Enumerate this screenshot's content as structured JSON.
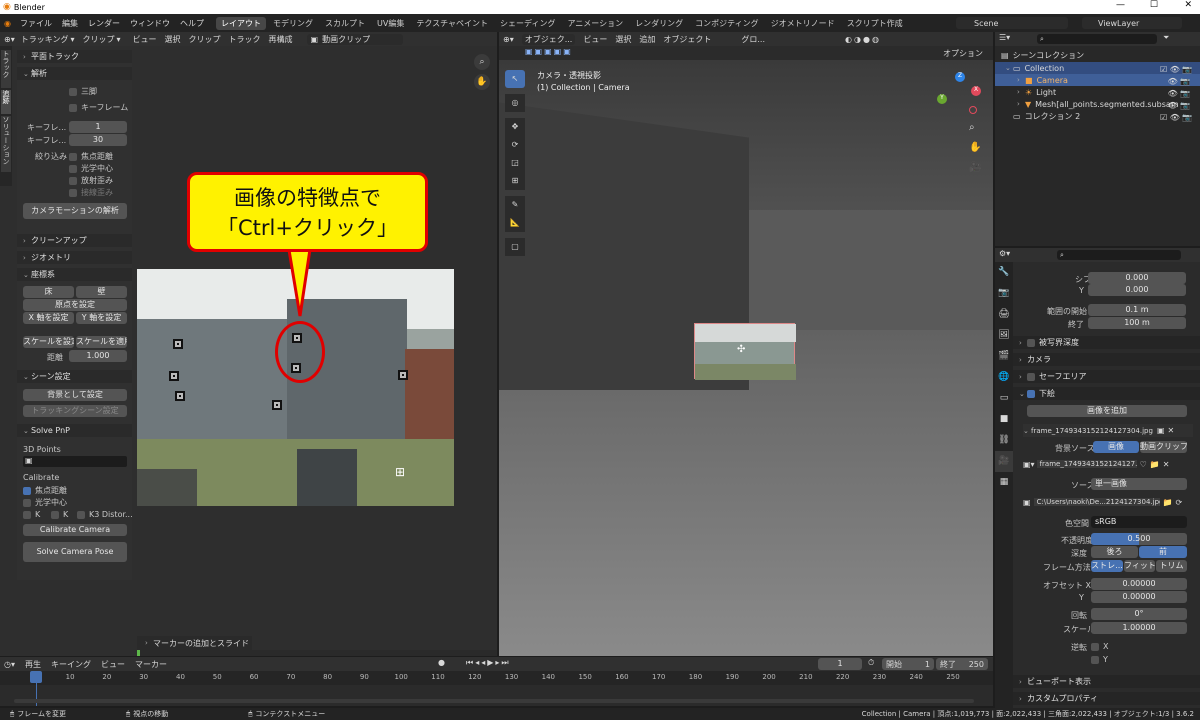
{
  "titlebar": {
    "app": "Blender"
  },
  "menubar": {
    "menus": [
      "ファイル",
      "編集",
      "レンダー",
      "ウィンドウ",
      "ヘルプ"
    ],
    "workspaces": [
      "レイアウト",
      "モデリング",
      "スカルプト",
      "UV編集",
      "テクスチャペイント",
      "シェーディング",
      "アニメーション",
      "レンダリング",
      "コンポジティング",
      "ジオメトリノード",
      "スクリプト作成"
    ],
    "scene": "Scene",
    "viewlayer": "ViewLayer"
  },
  "clip_editor": {
    "mode": "トラッキング",
    "view": "クリップ",
    "menus": [
      "ビュー",
      "選択",
      "クリップ",
      "トラック",
      "再構成"
    ],
    "clip_name": "動画クリップ",
    "side_tabs": [
      "トラック",
      "追跡",
      "ソリューション"
    ],
    "panel": {
      "plane_track": "平面トラック",
      "solve": "解析",
      "tripod": "三脚",
      "keyframe": "キーフレーム",
      "keyframe_a_label": "キーフレ...",
      "keyframe_a": "1",
      "keyframe_b_label": "キーフレ...",
      "keyframe_b": "30",
      "refine_label": "絞り込み",
      "focal": "焦点距離",
      "optical_center": "光学中心",
      "radial": "放射歪み",
      "tangential": "接線歪み",
      "solve_camera": "カメラモーションの解析",
      "cleanup": "クリーンアップ",
      "geometry": "ジオメトリ",
      "orientation": "座標系",
      "floor": "床",
      "wall": "壁",
      "set_origin": "原点を設定",
      "set_x": "X 軸を設定",
      "set_y": "Y 軸を設定",
      "set_scale": "スケールを設定",
      "apply_scale": "スケールを適用",
      "distance_label": "距離",
      "distance": "1.000",
      "scene_setup": "シーン設定",
      "set_bg": "背景として設定",
      "tracking_scene": "トラッキングシーン設定",
      "solve_pnp": "Solve PnP",
      "points3d": "3D Points",
      "calibrate": "Calibrate",
      "cal_focal": "焦点距離",
      "cal_optical": "光学中心",
      "k1": "K",
      "k2": "K",
      "k3": "K3 Distor...",
      "calibrate_btn": "Calibrate Camera",
      "solve_pose_btn": "Solve Camera Pose"
    },
    "callout": {
      "line1": "画像の特徴点で",
      "line2": "「Ctrl+クリック」"
    },
    "status_op": "マーカーの追加とスライド"
  },
  "viewport": {
    "mode": "オブジェク...",
    "menus": [
      "ビュー",
      "選択",
      "追加",
      "オブジェクト"
    ],
    "transform": "グロ...",
    "options": "オプション",
    "info_line1": "カメラ・透視投影",
    "info_line2": "(1) Collection | Camera"
  },
  "outliner": {
    "root": "シーンコレクション",
    "items": [
      {
        "name": "Collection",
        "level": 1
      },
      {
        "name": "Camera",
        "level": 2
      },
      {
        "name": "Light",
        "level": 2
      },
      {
        "name": "Mesh[all_points.segmented.subsam",
        "level": 2
      },
      {
        "name": "コレクション 2",
        "level": 1
      }
    ]
  },
  "properties": {
    "shift_x_label": "シフト X",
    "shift_x": "0.000",
    "shift_y_label": "Y",
    "shift_y": "0.000",
    "clip_start_label": "範囲の開始",
    "clip_start": "0.1 m",
    "clip_end_label": "終了",
    "clip_end": "100 m",
    "dof": "被写界深度",
    "camera": "カメラ",
    "safe": "セーフエリア",
    "bg": "下絵",
    "add_image": "画像を追加",
    "frame_name": "frame_1749343152124127304.jpg",
    "bg_source_label": "背景ソース",
    "bg_source_image": "画像",
    "bg_source_clip": "動画クリップ",
    "image_name": "frame_1749343152124127...",
    "source_label": "ソース",
    "source": "単一画像",
    "filepath": "C:\\Users\\naoki\\De...2124127304.jpg",
    "colorspace_label": "色空間",
    "colorspace": "sRGB",
    "opacity_label": "不透明度",
    "opacity": "0.500",
    "depth_label": "深度",
    "depth_back": "後ろ",
    "depth_front": "前",
    "frame_method_label": "フレーム方法",
    "frame_stretch": "ストレ...",
    "frame_fit": "フィット",
    "frame_crop": "トリム",
    "offset_x_label": "オフセット X",
    "offset_x": "0.00000",
    "offset_y_label": "Y",
    "offset_y": "0.00000",
    "rotation_label": "回転",
    "rotation": "0°",
    "scale_label": "スケール",
    "scale": "1.00000",
    "flip_label": "逆転",
    "flip_x": "X",
    "flip_y": "Y",
    "viewport_display": "ビューポート表示",
    "custom_props": "カスタムプロパティ"
  },
  "timeline": {
    "menus": [
      "再生",
      "キーイング",
      "ビュー",
      "マーカー"
    ],
    "current": "1",
    "start_label": "開始",
    "start": "1",
    "end_label": "終了",
    "end": "250",
    "ticks": [
      "1",
      "10",
      "20",
      "30",
      "40",
      "50",
      "60",
      "70",
      "80",
      "90",
      "100",
      "110",
      "120",
      "130",
      "140",
      "150",
      "160",
      "170",
      "180",
      "190",
      "200",
      "210",
      "220",
      "230",
      "240",
      "250"
    ]
  },
  "statusbar": {
    "left1": "フレームを変更",
    "left2": "視点の移動",
    "left3": "コンテクストメニュー",
    "right": "Collection | Camera | 頂点:1,019,773 | 面:2,022,433 | 三角面:2,022,433 | オブジェクト:1/3 | 3.6.2"
  }
}
